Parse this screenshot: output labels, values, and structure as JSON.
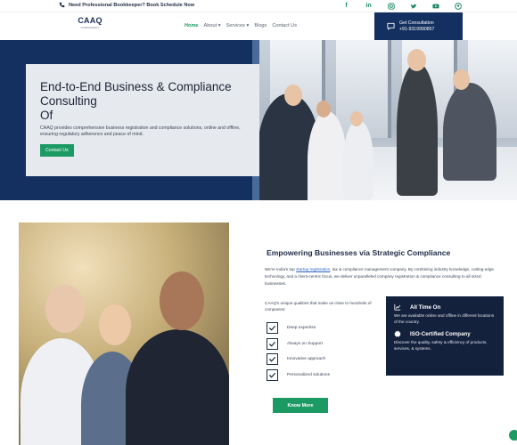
{
  "topbar": {
    "phone_text": "Need Professional Bookkeeper? Book Schedule Now",
    "social_icons": [
      "facebook-icon",
      "linkedin-icon",
      "instagram-icon",
      "twitter-icon",
      "youtube-icon",
      "pinterest-icon"
    ]
  },
  "header": {
    "logo_text": "CAAQ",
    "logo_sub": "CONSULTANCY",
    "nav": [
      {
        "label": "Home",
        "active": true
      },
      {
        "label": "About ▾"
      },
      {
        "label": "Services ▾"
      },
      {
        "label": "Blogs"
      },
      {
        "label": "Contact Us"
      }
    ],
    "cta_label": "Get Consultation",
    "cta_phone": "+91-9319990857"
  },
  "hero": {
    "title_line1": "End-to-End Business & Compliance",
    "title_line2": "Consulting",
    "title_line3": "Of",
    "description": "CAAQ provides comprehensive business registration and compliance solutions, online and offline, ensuring regulatory adherence and peace of mind.",
    "button_label": "Contact Us"
  },
  "about": {
    "title": "Empowering Businesses via Strategic Compliance",
    "text_before_link": "We're India's top ",
    "link_text": "startup registration",
    "text_after_link": ", tax & compliance management company. By combining industry knowledge, cutting-edge technology, and a client-centric focus, we deliver unparalleled company registration & compliance consulting to all sized businesses.",
    "intro": "CAAQ's unique qualities that make us close to hundreds of companies:",
    "checks": [
      "Deep expertise",
      "Always on Support",
      "Innovative approach",
      "Personalized solutions"
    ],
    "button_label": "Know More"
  },
  "features": [
    {
      "icon": "chart-icon",
      "title": "All Time On",
      "desc": "We are available online and offline in different locations of the country."
    },
    {
      "icon": "badge-icon",
      "title": "ISO-Certified Company",
      "desc": "Discover the quality, safety & efficiency of products, services, & systems."
    }
  ],
  "colors": {
    "navy": "#143060",
    "green": "#1b9a63",
    "dark_card": "#14213d"
  }
}
